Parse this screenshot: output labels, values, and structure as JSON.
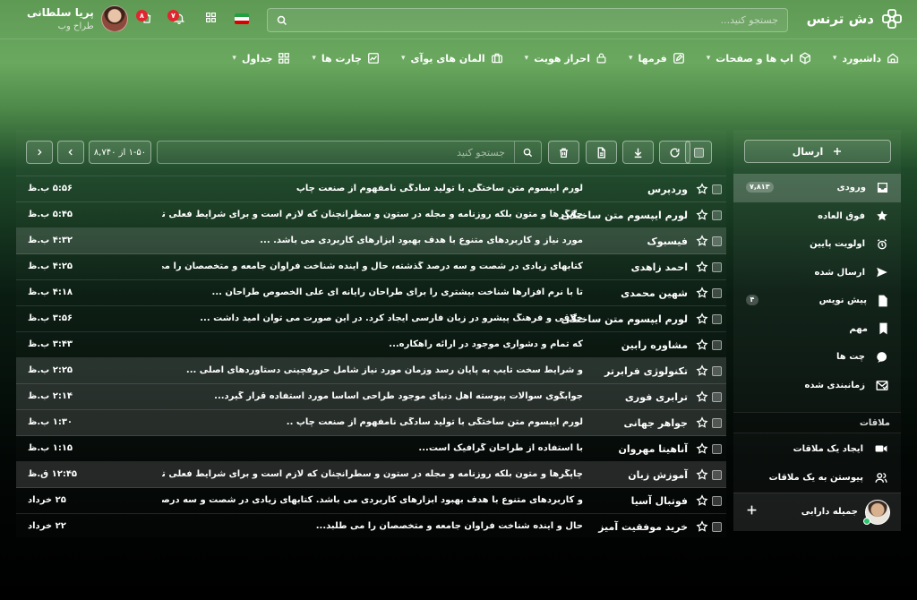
{
  "app": {
    "logo_text": "دش ترنس"
  },
  "header": {
    "search_placeholder": "جستجو کنید...",
    "notifications_badge": "۷",
    "cart_badge": "۸",
    "user_name": "پریا سلطانی",
    "user_role": "طراح وب",
    "flag_colors": [
      "#239f40",
      "#ffffff",
      "#da0000"
    ]
  },
  "nav": [
    {
      "label": "داشبورد",
      "icon": "home-icon"
    },
    {
      "label": "اپ ها و صفحات",
      "icon": "cube-icon"
    },
    {
      "label": "فرمها",
      "icon": "edit-icon"
    },
    {
      "label": "احراز هویت",
      "icon": "lock-icon"
    },
    {
      "label": "المان های یوآی",
      "icon": "briefcase-icon"
    },
    {
      "label": "چارت ها",
      "icon": "chart-icon"
    },
    {
      "label": "جداول",
      "icon": "grid-icon"
    }
  ],
  "mail_toolbar": {
    "search_placeholder": "جستجو کنید",
    "pager_text": "۱-۵۰ از ۸,۷۴۰"
  },
  "emails": [
    {
      "sender": "وردپرس",
      "subject": "لورم ایپسوم متن ساختگی با تولید سادگی نامفهوم از صنعت چاپ",
      "time": "۵:۵۶ ب.ظ",
      "highlighted": false
    },
    {
      "sender": "لورم ایپسوم متن ساختگی",
      "subject": "چاپگرها و متون بلکه روزنامه و مجله در ستون و سطرآنچنان که لازم است و برای شرایط فعلی تکنولوژی...",
      "time": "۵:۴۵ ب.ظ",
      "highlighted": false
    },
    {
      "sender": "فیسبوک",
      "subject": "مورد نیاز و کاربردهای متنوع با هدف بهبود ابزارهای کاربردی می باشد. ...",
      "time": "۴:۳۲ ب.ظ",
      "highlighted": true
    },
    {
      "sender": "احمد زاهدی",
      "subject": "کتابهای زیادی در شصت و سه درصد گذشته، حال و آینده شناخت فراوان جامعه و متخصصان را می طلبد...",
      "time": "۴:۲۵ ب.ظ",
      "highlighted": false
    },
    {
      "sender": "شهین محمدی",
      "subject": "تا با نرم افزارها شناخت بیشتری را برای طراحان رایانه ای علی الخصوص طراحان ...",
      "time": "۴:۱۸ ب.ظ",
      "highlighted": false
    },
    {
      "sender": "لورم ایپسوم متن ساختگی",
      "subject": "خلاقی و فرهنگ پیشرو در زبان فارسی ایجاد کرد. در این صورت می توان امید داشت ...",
      "time": "۳:۵۶ ب.ظ",
      "highlighted": false
    },
    {
      "sender": "مشاوره رابین",
      "subject": "که تمام و دشواری موجود در ارائه راهکاره...",
      "time": "۳:۴۳ ب.ظ",
      "highlighted": false
    },
    {
      "sender": "تکنولوژی فرابرتر",
      "subject": "و شرایط سخت تایپ به پایان رسد وزمان مورد نیاز شامل حروفچینی دستاوردهای اصلی ...",
      "time": "۲:۲۵ ب.ظ",
      "highlighted": true
    },
    {
      "sender": "ترابری فوری",
      "subject": "جوابگوی سوالات پیوسته اهل دنیای موجود طراحی اساسا مورد استفاده قرار گیرد...",
      "time": "۲:۱۴ ب.ظ",
      "highlighted": true
    },
    {
      "sender": "جواهر جهانی",
      "subject": "لورم ایپسوم متن ساختگی با تولید سادگی نامفهوم از صنعت چاپ ..",
      "time": "۱:۳۰ ب.ظ",
      "highlighted": true
    },
    {
      "sender": "آناهیتا مهروان",
      "subject": "با استفاده از طراحان گرافیک است...",
      "time": "۱:۱۵ ب.ظ",
      "highlighted": false
    },
    {
      "sender": "آموزش زبان",
      "subject": "چاپگرها و متون بلکه روزنامه و مجله در ستون و سطرآنچنان که لازم است و برای شرایط فعلی تکنولوژی مورد نیاز ...",
      "time": "۱۲:۴۵ ق.ظ",
      "highlighted": true
    },
    {
      "sender": "فوتبال آسیا",
      "subject": "و کاربردهای متنوع با هدف بهبود ابزارهای کاربردی می باشد. کتابهای زیادی در شصت و سه درصد گذشته...",
      "time": "۲۵ خرداد",
      "highlighted": false
    },
    {
      "sender": "خرید موفقیت آمیز",
      "subject": "حال و آینده شناخت فراوان جامعه و متخصصان را می طلبد...",
      "time": "۲۲ خرداد",
      "highlighted": false
    }
  ],
  "sidebar": {
    "compose_label": "ارسال",
    "folders": [
      {
        "label": "ورودی",
        "icon": "inbox-icon",
        "count": "۷,۸۱۳",
        "active": true
      },
      {
        "label": "فوق العاده",
        "icon": "star-icon",
        "count": "",
        "active": false
      },
      {
        "label": "اولویت پایین",
        "icon": "alarm-icon",
        "count": "",
        "active": false
      },
      {
        "label": "ارسال شده",
        "icon": "send-icon",
        "count": "",
        "active": false
      },
      {
        "label": "پیش نویس",
        "icon": "file-icon",
        "count": "۴",
        "active": false
      },
      {
        "label": "مهم",
        "icon": "bookmark-icon",
        "count": "",
        "active": false
      },
      {
        "label": "چت ها",
        "icon": "chat-icon",
        "count": "",
        "active": false
      },
      {
        "label": "زمانبندی شده",
        "icon": "mail-scheduled-icon",
        "count": "",
        "active": false
      }
    ],
    "meetings_title": "ملاقات",
    "meetings": [
      {
        "label": "ایجاد یک ملاقات",
        "icon": "video-icon"
      },
      {
        "label": "پیوستن به یک ملاقات",
        "icon": "users-icon"
      }
    ],
    "contact_name": "جمیله دارابی"
  },
  "colors": {
    "badge": "#e0262e",
    "online": "#28c76f"
  }
}
